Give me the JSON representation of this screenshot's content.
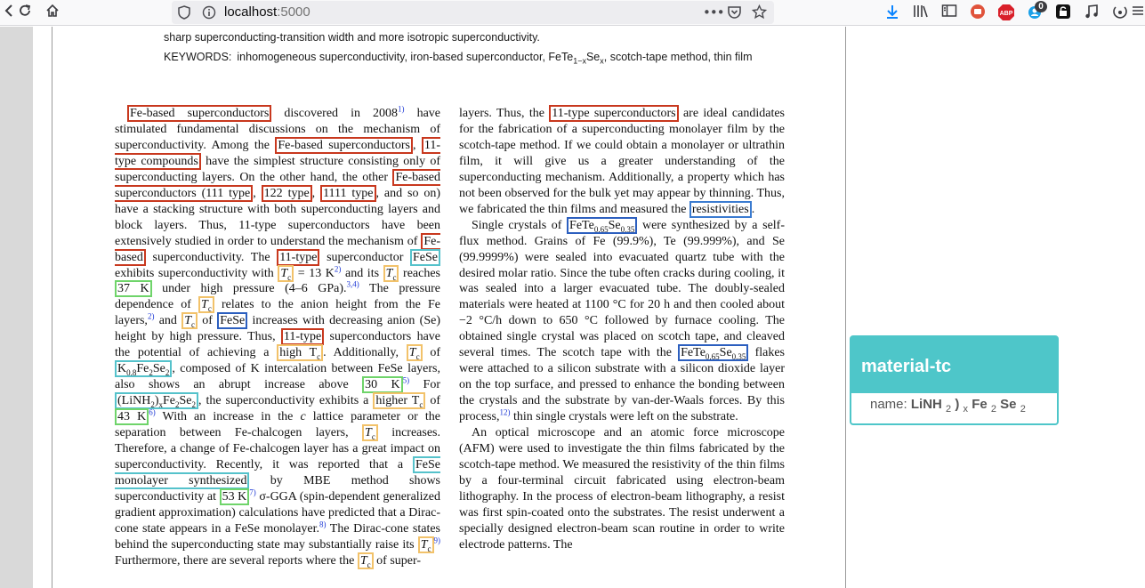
{
  "browser": {
    "url_host": "localhost",
    "url_port": ":5000",
    "toolbar_badge_count": "0",
    "extension_abp": "ABP",
    "icons": [
      "back-icon",
      "reload-icon",
      "home-icon",
      "shield-icon",
      "info-icon",
      "more-icon",
      "pocket-icon",
      "bookmark-star-icon",
      "download-icon",
      "library-icon",
      "sidebar-icon",
      "extension-icon",
      "abp-icon",
      "notification-icon",
      "lock-extension-icon",
      "music-icon",
      "camera-icon",
      "menu-icon"
    ]
  },
  "paper": {
    "abstract_tail": "sharp superconducting-transition width and more isotropic superconductivity.",
    "keywords_label": "KEYWORDS:",
    "keywords": "inhomogeneous superconductivity, iron-based superconductor, FeTe",
    "keywords_sub": "1−x",
    "keywords_mid": "Se",
    "keywords_sub2": "x",
    "keywords_end": ", scotch-tape method, thin film",
    "left_column": {
      "t_fe_based_1": "Fe-based superconductors",
      "t_discovered": " discovered in 2008",
      "ref1": "1)",
      "t_stimulated": " have stimulated fundamental discussions on the mechanism of superconductivity. Among the ",
      "t_fe_based_2": "Fe-based superconductors",
      "t_comma": ",",
      "t_11type_compounds": "11-type compounds",
      "t_simplest": " have the simplest structure consisting only of superconducting layers. On the other hand, the other ",
      "t_fe_based_111": "Fe-based superconductors (111 type",
      "t_c1": ",",
      "t_122": "122 type",
      "t_c2": ",",
      "t_1111": "1111 type",
      "t_c3": ",",
      "t_soon": " and so on) have a stacking structure with both superconducting layers and block layers. Thus, 11-type superconductors have been extensively studied in order to understand the mechanism of ",
      "t_fe_based_3": "Fe-based",
      "t_sc": " superconductivity. The ",
      "t_11type_a": "11-type",
      "t_superconductor": " superconductor ",
      "t_fese_a": "FeSe",
      "t_exhibits": " exhibits superconductivity with ",
      "t_tc_a": "T",
      "t_tc_a_sub": "c",
      "t_eq13k": " = 13 K",
      "ref2": "2)",
      "t_andits": " and its ",
      "t_tc_b": "T",
      "t_tc_b_sub": "c",
      "t_reaches": " reaches ",
      "t_37k": "37 K",
      "t_under": " under high pressure (4–6 GPa).",
      "ref34": "3,4)",
      "t_pressure": " The pressure dependence of ",
      "t_tc_c": "T",
      "t_tc_c_sub": "c",
      "t_relates": " relates to the anion height from the Fe layers,",
      "ref2b": "2)",
      "t_and": " and ",
      "t_tc_d": "T",
      "t_tc_d_sub": "c",
      "t_of": " of ",
      "t_fese_b": "FeSe",
      "t_increases": " increases with decreasing anion (Se) height by high pressure. Thus, ",
      "t_11type_b": "11-type",
      "t_potential": " superconductors have the potential of achieving a ",
      "t_high_tc": "high T",
      "t_high_tc_sub": "c",
      "t_additionally": ". Additionally, ",
      "t_tc_e": "T",
      "t_tc_e_sub": "c",
      "t_of2": " of ",
      "t_k08": "K",
      "t_k08_sub": "0.8",
      "t_k08_fe": "Fe",
      "t_k08_sub2": "2",
      "t_k08_se": "Se",
      "t_k08_sub3": "2",
      "t_composed": ", composed of K intercalation between FeSe layers, also shows an abrupt increase above ",
      "t_30k": "30 K",
      "ref5": "5)",
      "t_for": " For ",
      "t_linh": "(LiNH",
      "t_linh_sub": "2",
      "t_linh_x": ")",
      "t_linh_xsub": "x",
      "t_linh_fe": "Fe",
      "t_linh_sub2": "2",
      "t_linh_se": "Se",
      "t_linh_sub3": "2",
      "t_exhibits2": ", the superconductivity exhibits a ",
      "t_higher_tc": "higher T",
      "t_higher_tc_sub": "c",
      "t_of3": " of ",
      "t_43k": "43 K",
      "ref6": "6)",
      "t_with": " With an increase in the ",
      "t_c_it": "c",
      "t_lattice": " lattice parameter or the separation between Fe-chalcogen layers, ",
      "t_tc_f": "T",
      "t_tc_f_sub": "c",
      "t_therefore": " increases. Therefore, a change of Fe-chalcogen layer has a great impact on superconductivity. Recently, it was reported that a ",
      "t_fese_mono": "FeSe monolayer synthesized",
      "t_mbe": " by MBE method shows superconductivity at ",
      "t_53k": "53 K",
      "ref7": "7)",
      "t_sigma": " σ-GGA (spin-dependent generalized gradient approximation) calculations have predicted that a Dirac-cone state appears in a FeSe monolayer.",
      "ref8": "8)",
      "t_dirac": " The Dirac-cone states behind the superconducting state may substantially raise its ",
      "t_tc_g": "T",
      "t_tc_g_sub": "c",
      "ref9": "9)",
      "t_further": " Furthermore, there are several reports where the ",
      "t_tc_h": "T",
      "t_tc_h_sub": "c",
      "t_ofsuper": " of super-"
    },
    "right_column": {
      "p1_a": "layers. Thus, the ",
      "p1_11type": "11-type superconductors",
      "p1_b": " are ideal candidates for the fabrication of a superconducting monolayer film by the scotch-tape method. If we could obtain a monolayer or ultrathin film, it will give us a greater understanding of the superconducting mechanism. Additionally, a property which has not been observed for the bulk yet may appear by thinning. Thus, we fabricated the thin films and measured the ",
      "p1_resist": "resistivities",
      "p1_c": ".",
      "p2_a": "Single crystals of ",
      "p2_fete": "FeTe",
      "p2_fete_sub": "0.65",
      "p2_fete_se": "Se",
      "p2_fete_sub2": "0.35",
      "p2_b": " were synthesized by a self-flux method. Grains of Fe (99.9%), Te (99.999%), and Se (99.9999%) were sealed into evacuated quartz tube with the desired molar ratio. Since the tube often cracks during cooling, it was sealed into a larger evacuated tube. The doubly-sealed materials were heated at 1100 °C for 20 h and then cooled about −2 °C/h down to 650 °C followed by furnace cooling. The obtained single crystal was placed on scotch tape, and cleaved several times. The scotch tape with the ",
      "p2_fete2": "FeTe",
      "p2_fete2_sub": "0.65",
      "p2_fete2_se": "Se",
      "p2_fete2_sub2": "0.35",
      "p2_c": " flakes were attached to a silicon substrate with a silicon dioxide layer on the top surface, and pressed to enhance the bonding between the crystals and the substrate by van-der-Waals forces. By this process,",
      "ref12": "12)",
      "p2_d": " thin single crystals were left on the substrate.",
      "p3": "An optical microscope and an atomic force microscope (AFM) were used to investigate the thin films fabricated by the scotch-tape method. We measured the resistivity of the thin films by a four-terminal circuit fabricated using electron-beam lithography. In the process of electron-beam lithography, a resist was first spin-coated onto the substrates. The resist underwent a specially designed electron-beam scan routine in order to write electrode patterns. The"
    }
  },
  "tooltip": {
    "title": "material-tc",
    "name_label": "name:",
    "name_a": "LiNH",
    "name_sub1": "2",
    "name_b": ")",
    "name_sub2": "x",
    "name_c": "Fe",
    "name_sub3": "2",
    "name_d": "Se",
    "name_sub4": "2"
  },
  "colors": {
    "material": "#c8381e",
    "sample": "#2c5fbf",
    "tc": "#f2c26a",
    "value": "#6fd46a",
    "formula": "#55c2cb",
    "tooltip_header": "#4ec6c9"
  }
}
